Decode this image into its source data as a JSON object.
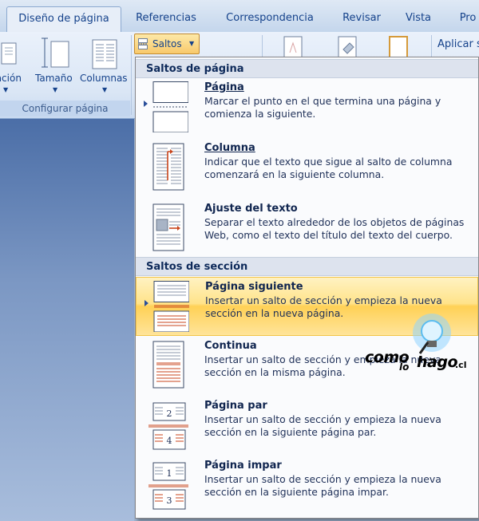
{
  "tabs": [
    "Diseño de página",
    "Referencias",
    "Correspondencia",
    "Revisar",
    "Vista",
    "Pro"
  ],
  "ribbon": {
    "buttons": [
      "tación",
      "Tamaño",
      "Columnas"
    ],
    "group_label": "Configurar página",
    "saltos_label": "Saltos",
    "aplicar_label": "Aplicar s"
  },
  "menu": {
    "section1_header": "Saltos de página",
    "section2_header": "Saltos de sección",
    "items": [
      {
        "title": "Página",
        "desc": "Marcar el punto en el que termina una página y comienza la siguiente."
      },
      {
        "title": "Columna",
        "desc": "Indicar que el texto que sigue al salto de columna comenzará en la siguiente columna."
      },
      {
        "title": "Ajuste del texto",
        "desc": "Separar el texto alrededor de los objetos de páginas Web, como el texto del título del texto del cuerpo."
      },
      {
        "title": "Página siguiente",
        "desc": "Insertar un salto de sección y empieza la nueva sección en la nueva página."
      },
      {
        "title": "Continua",
        "desc": "Insertar un salto de sección y empieza la nueva sección en la misma página."
      },
      {
        "title": "Página par",
        "desc": "Insertar un salto de sección y empieza la nueva sección en la siguiente página par."
      },
      {
        "title": "Página impar",
        "desc": "Insertar un salto de sección y empieza la nueva sección en la siguiente página impar."
      }
    ],
    "page_numbers": [
      "2",
      "4",
      "1",
      "3"
    ]
  },
  "watermark": {
    "w1": "como",
    "w2": "lo",
    "w3": "hago",
    "w4": ".cl"
  },
  "colors": {
    "highlight": "#ffd156",
    "ribbon_text": "#15428b",
    "break_line": "#c8451c"
  }
}
